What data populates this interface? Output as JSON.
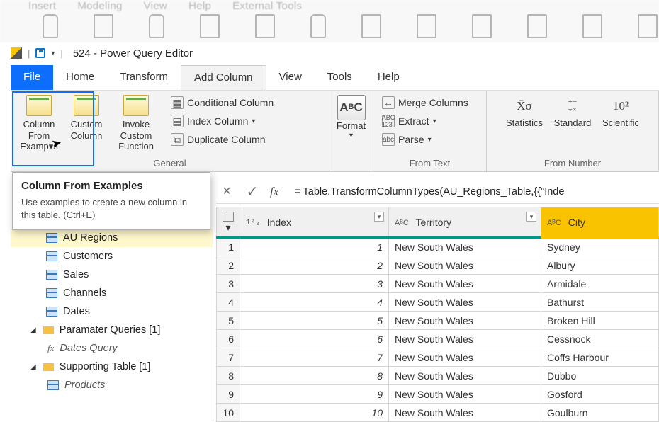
{
  "bg_menu": [
    "Insert",
    "Modeling",
    "View",
    "Help",
    "External Tools"
  ],
  "window_title": "524 - Power Query Editor",
  "tabs": {
    "file": "File",
    "home": "Home",
    "transform": "Transform",
    "add_column": "Add Column",
    "view": "View",
    "tools": "Tools",
    "help": "Help"
  },
  "ribbon": {
    "general": {
      "col_from_examples": "Column From Examples",
      "custom_column": "Custom Column",
      "invoke_custom": "Invoke Custom Function",
      "conditional": "Conditional Column",
      "index": "Index Column",
      "duplicate": "Duplicate Column",
      "group": "General"
    },
    "format": {
      "label": "Format"
    },
    "from_text": {
      "merge": "Merge Columns",
      "extract": "Extract",
      "parse": "Parse",
      "group": "From Text"
    },
    "from_number": {
      "statistics": "Statistics",
      "standard": "Standard",
      "scientific": "Scientific",
      "group": "From Number"
    }
  },
  "tooltip": {
    "title": "Column From Examples",
    "body": "Use examples to create a new column in this table. (Ctrl+E)"
  },
  "queries": {
    "items": [
      {
        "name": "AU Regions",
        "icon": "table",
        "sel": true
      },
      {
        "name": "Customers",
        "icon": "table"
      },
      {
        "name": "Sales",
        "icon": "table"
      },
      {
        "name": "Channels",
        "icon": "table"
      },
      {
        "name": "Dates",
        "icon": "table"
      }
    ],
    "folder1": "Paramater Queries [1]",
    "fx": "Dates Query",
    "folder2": "Supporting Table [1]",
    "products": "Products"
  },
  "formula": "= Table.TransformColumnTypes(AU_Regions_Table,{{\"Inde",
  "columns": {
    "index": "Index",
    "territory": "Territory",
    "city": "City"
  },
  "rows": [
    {
      "n": 1,
      "idx": 1,
      "terr": "New South Wales",
      "city": "Sydney"
    },
    {
      "n": 2,
      "idx": 2,
      "terr": "New South Wales",
      "city": "Albury"
    },
    {
      "n": 3,
      "idx": 3,
      "terr": "New South Wales",
      "city": "Armidale"
    },
    {
      "n": 4,
      "idx": 4,
      "terr": "New South Wales",
      "city": "Bathurst"
    },
    {
      "n": 5,
      "idx": 5,
      "terr": "New South Wales",
      "city": "Broken Hill"
    },
    {
      "n": 6,
      "idx": 6,
      "terr": "New South Wales",
      "city": "Cessnock"
    },
    {
      "n": 7,
      "idx": 7,
      "terr": "New South Wales",
      "city": "Coffs Harbour"
    },
    {
      "n": 8,
      "idx": 8,
      "terr": "New South Wales",
      "city": "Dubbo"
    },
    {
      "n": 9,
      "idx": 9,
      "terr": "New South Wales",
      "city": "Gosford"
    },
    {
      "n": 10,
      "idx": 10,
      "terr": "New South Wales",
      "city": "Goulburn"
    }
  ]
}
